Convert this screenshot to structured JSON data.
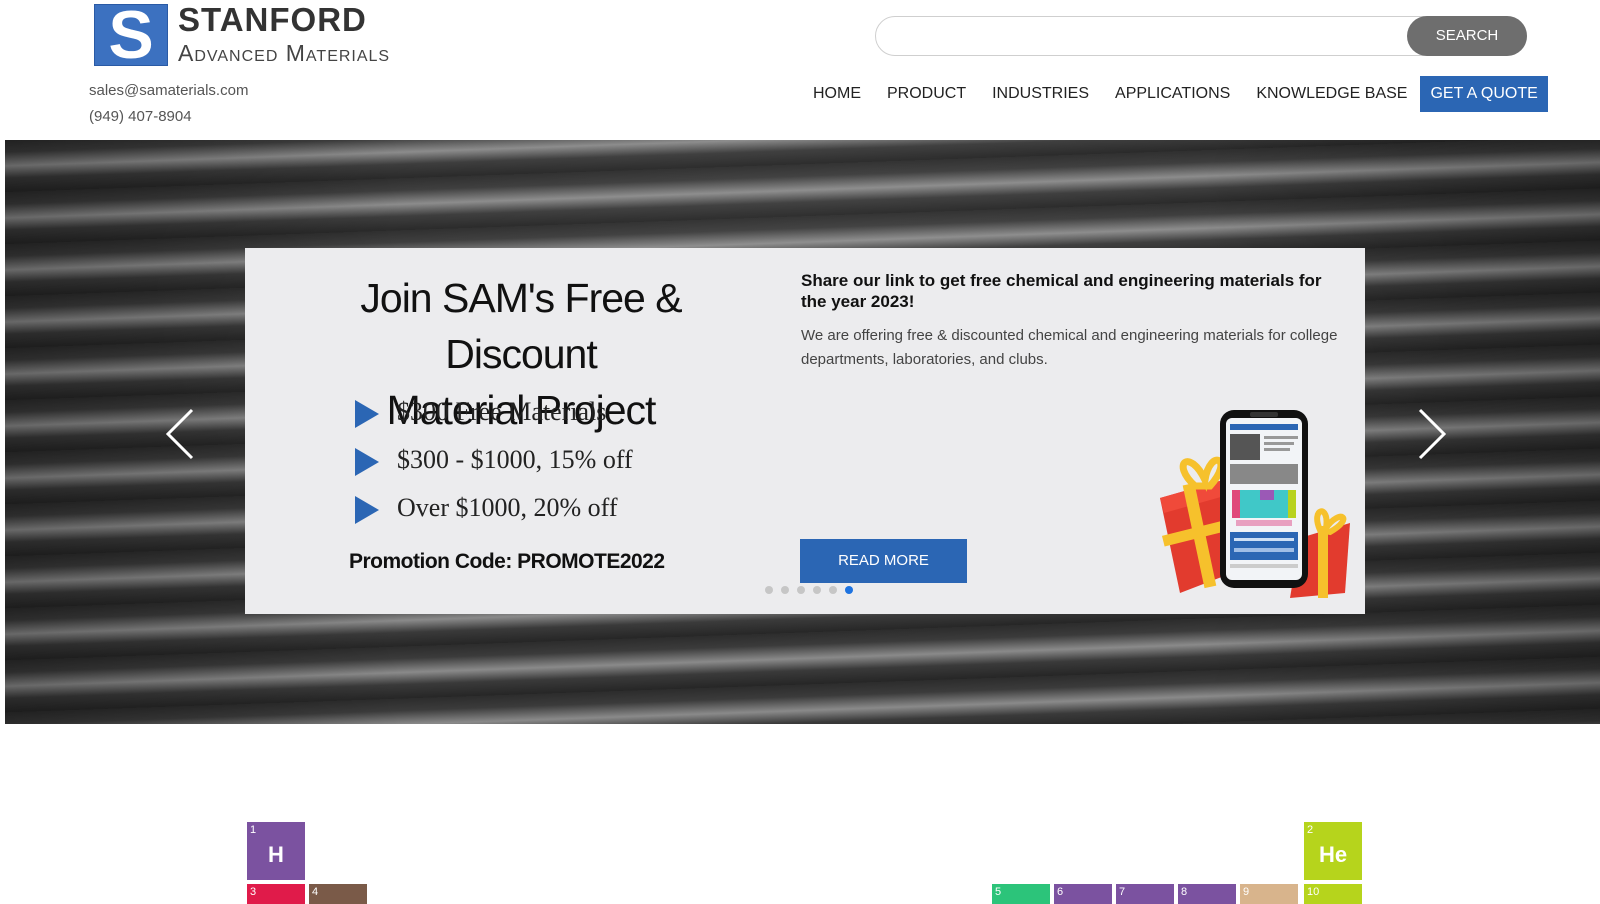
{
  "header": {
    "logo": {
      "letter": "S",
      "name": "STANFORD",
      "subtitle": "Advanced Materials"
    },
    "email": "sales@samaterials.com",
    "phone": "(949) 407-8904",
    "search": {
      "placeholder": "",
      "button_label": "SEARCH"
    },
    "nav": {
      "items": [
        "HOME",
        "PRODUCT",
        "INDUSTRIES",
        "APPLICATIONS",
        "KNOWLEDGE BASE"
      ],
      "cta_label": "GET A QUOTE"
    }
  },
  "hero": {
    "promo": {
      "title_line1": "Join SAM's Free & Discount",
      "title_line2": "Material Project",
      "offers": [
        "$300 Free Materials",
        "$300 - $1000, 15% off",
        "Over $1000, 20% off"
      ],
      "promotion_code": "Promotion Code: PROMOTE2022",
      "right_title": "Share our link to get free chemical and engineering materials for the year 2023!",
      "right_text": "We are offering free & discounted chemical and engineering materials for college departments, laboratories, and clubs.",
      "read_more_label": "READ MORE"
    },
    "slides_count": 6,
    "active_slide": 6
  },
  "periodic_table": {
    "elements": [
      {
        "number": "1",
        "symbol": "H",
        "color": "#7b52a0"
      },
      {
        "number": "2",
        "symbol": "He",
        "color": "#b6d41c"
      },
      {
        "number": "3",
        "symbol": "",
        "color": "#e01b4a"
      },
      {
        "number": "4",
        "symbol": "",
        "color": "#7a5a48"
      },
      {
        "number": "5",
        "symbol": "",
        "color": "#2cc47a"
      },
      {
        "number": "6",
        "symbol": "",
        "color": "#7b52a0"
      },
      {
        "number": "7",
        "symbol": "",
        "color": "#7b52a0"
      },
      {
        "number": "8",
        "symbol": "",
        "color": "#7b52a0"
      },
      {
        "number": "9",
        "symbol": "",
        "color": "#d8b48c"
      },
      {
        "number": "10",
        "symbol": "",
        "color": "#b6d41c"
      }
    ]
  },
  "colors": {
    "brand_blue": "#2b66b4",
    "dot_active": "#1e73e0"
  }
}
